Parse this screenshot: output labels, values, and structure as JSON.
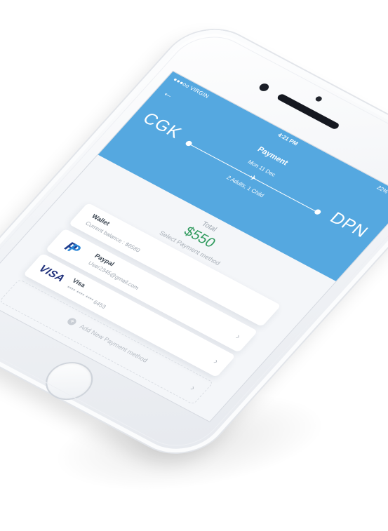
{
  "status_bar": {
    "carrier": "●●●oo VIRGIN",
    "time": "4:21 PM",
    "battery": "22%"
  },
  "header": {
    "title": "Payment",
    "from": "CGK",
    "to": "DPN",
    "date": "Mon 11 Dec",
    "passengers": "2 Adults, 1 Child"
  },
  "summary": {
    "total_label": "Total",
    "total_value": "$550",
    "select_label": "Select Payment method"
  },
  "methods": {
    "wallet": {
      "name": "Wallet",
      "detail": "Current balance : $6580"
    },
    "paypal": {
      "name": "Paypal",
      "detail": "User2345@gmail.com"
    },
    "visa": {
      "name": "Visa",
      "detail": "**** **** **** 6453",
      "logo": "VISA"
    },
    "add": {
      "label": "Add New Payment method"
    }
  },
  "colors": {
    "header_blue": "#55a8e0",
    "total_green": "#2f9a5d"
  }
}
